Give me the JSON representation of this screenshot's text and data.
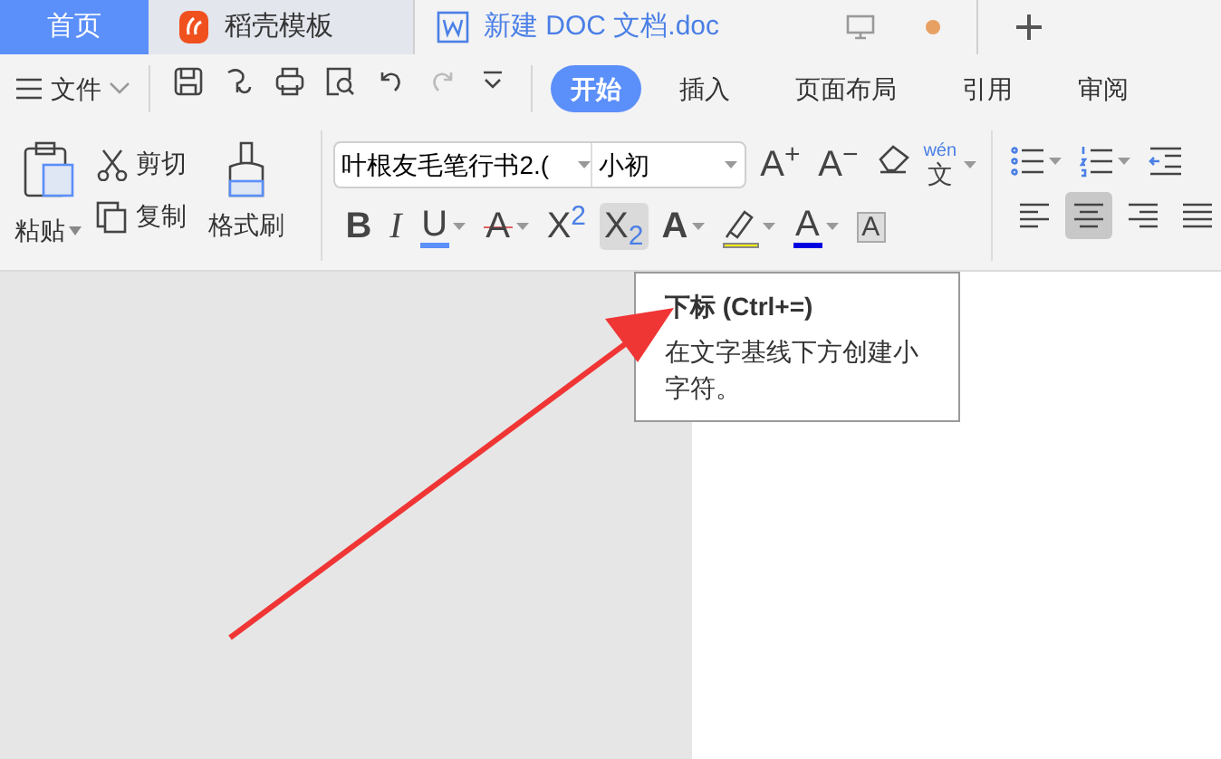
{
  "window_tabs": [
    {
      "label": "首页",
      "kind": "home",
      "selected": false
    },
    {
      "label": "稻壳模板",
      "kind": "docer",
      "selected": false
    },
    {
      "label": "新建 DOC 文档.doc",
      "kind": "document",
      "selected": true
    }
  ],
  "menu": {
    "file_label": "文件",
    "ribbon_tabs": [
      {
        "label": "开始",
        "selected": true
      },
      {
        "label": "插入",
        "selected": false
      },
      {
        "label": "页面布局",
        "selected": false
      },
      {
        "label": "引用",
        "selected": false
      },
      {
        "label": "审阅",
        "selected": false
      }
    ]
  },
  "clipboard": {
    "paste": "粘贴",
    "cut": "剪切",
    "copy": "复制",
    "format_painter": "格式刷"
  },
  "font": {
    "name": "叶根友毛笔行书2.(",
    "size": "小初",
    "grow": "A$^{+}$",
    "shrink": "A$^{−}$",
    "pinyin_top": "wén",
    "pinyin_bottom": "文",
    "format_buttons": [
      {
        "kind": "bold",
        "glyph": "B",
        "selected": false
      },
      {
        "kind": "italic",
        "glyph": "I",
        "selected": false
      },
      {
        "kind": "underline",
        "glyph": "U",
        "selected": false
      },
      {
        "kind": "strike",
        "glyph": "A",
        "selected": false
      },
      {
        "kind": "superscript",
        "glyph": "X$^{2}$",
        "selected": false
      },
      {
        "kind": "subscript",
        "glyph": "X$_{2}$",
        "selected": true
      },
      {
        "kind": "outline",
        "glyph": "A",
        "selected": false
      },
      {
        "kind": "highlight",
        "selected": false
      },
      {
        "kind": "color",
        "glyph": "A",
        "selected": false
      },
      {
        "kind": "shade",
        "glyph": "A",
        "selected": false
      }
    ]
  },
  "paragraph": {
    "align": [
      {
        "kind": "left",
        "selected": false
      },
      {
        "kind": "center",
        "selected": true
      },
      {
        "kind": "right",
        "selected": false
      },
      {
        "kind": "justify",
        "selected": false
      }
    ]
  },
  "tooltip": {
    "title": "下标 (Ctrl+=)",
    "body": "在文字基线下方创建小字符。"
  }
}
